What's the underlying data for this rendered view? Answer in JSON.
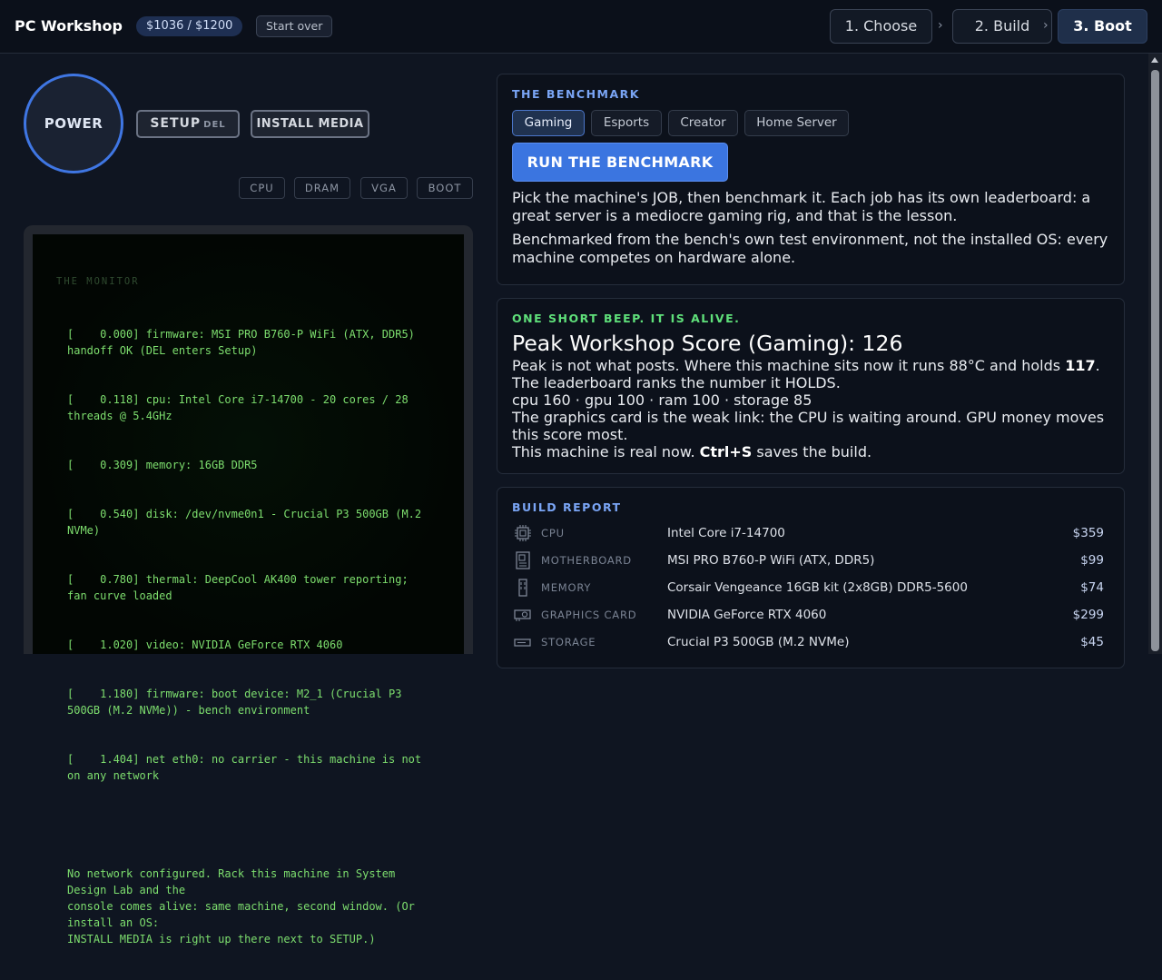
{
  "header": {
    "brand": "PC Workshop",
    "budget": "$1036 / $1200",
    "start_over": "Start over",
    "steps": [
      "1. Choose",
      "2. Build",
      "3. Boot"
    ],
    "active_step": "3. Boot",
    "chevron": "›"
  },
  "controls": {
    "power": "POWER",
    "setup": "SETUP",
    "setup_key": "DEL",
    "install_media": "INSTALL MEDIA",
    "post_leds": [
      "CPU",
      "DRAM",
      "VGA",
      "BOOT"
    ]
  },
  "monitor": {
    "title": "THE MONITOR",
    "log": [
      "[    0.000] firmware: MSI PRO B760-P WiFi (ATX, DDR5) handoff OK (DEL enters Setup)",
      "[    0.118] cpu: Intel Core i7-14700 - 20 cores / 28 threads @ 5.4GHz",
      "[    0.309] memory: 16GB DDR5",
      "[    0.540] disk: /dev/nvme0n1 - Crucial P3 500GB (M.2 NVMe)",
      "[    0.780] thermal: DeepCool AK400 tower reporting; fan curve loaded",
      "[    1.020] video: NVIDIA GeForce RTX 4060",
      "[    1.180] firmware: boot device: M2_1 (Crucial P3 500GB (M.2 NVMe)) - bench environment",
      "[    1.404] net eth0: no carrier - this machine is not on any network",
      "",
      "No network configured. Rack this machine in System Design Lab and the\nconsole comes alive: same machine, second window. (Or install an OS:\nINSTALL MEDIA is right up there next to SETUP.)"
    ]
  },
  "benchmark": {
    "label": "THE BENCHMARK",
    "tabs": [
      "Gaming",
      "Esports",
      "Creator",
      "Home Server"
    ],
    "selected_tab": "Gaming",
    "run_button": "RUN THE BENCHMARK",
    "para1": "Pick the machine's JOB, then benchmark it. Each job has its own leaderboard: a great server is a mediocre gaming rig, and that is the lesson.",
    "para2": "Benchmarked from the bench's own test environment, not the installed OS: every machine competes on hardware alone."
  },
  "result": {
    "label": "ONE SHORT BEEP. IT IS ALIVE.",
    "score_line": "Peak Workshop Score (Gaming): 126",
    "peak_pre": "Peak is not what posts. Where this machine sits now it runs 88°C and holds ",
    "holds_value": "117",
    "peak_post": ".",
    "leaderboard_line": "The leaderboard ranks the number it HOLDS.",
    "subscores": "cpu 160 · gpu 100 · ram 100 · storage 85",
    "weak_link": "The graphics card is the weak link: the CPU is waiting around. GPU money moves this score most.",
    "real_pre": "This machine is real now. ",
    "real_key": "Ctrl+S",
    "real_post": " saves the build."
  },
  "report": {
    "label": "BUILD REPORT",
    "rows": [
      {
        "category": "CPU",
        "part": "Intel Core i7-14700",
        "price": "$359",
        "icon": "cpu-icon"
      },
      {
        "category": "MOTHERBOARD",
        "part": "MSI PRO B760-P WiFi (ATX, DDR5)",
        "price": "$99",
        "icon": "motherboard-icon"
      },
      {
        "category": "MEMORY",
        "part": "Corsair Vengeance 16GB kit (2x8GB) DDR5-5600",
        "price": "$74",
        "icon": "memory-icon"
      },
      {
        "category": "GRAPHICS CARD",
        "part": "NVIDIA GeForce RTX 4060",
        "price": "$299",
        "icon": "gpu-icon"
      },
      {
        "category": "STORAGE",
        "part": "Crucial P3 500GB (M.2 NVMe)",
        "price": "$45",
        "icon": "storage-icon"
      }
    ]
  },
  "colors": {
    "accent": "#3b75e0",
    "benchmark_label": "#7aa5f5",
    "alive_label": "#5fe07a",
    "report_label": "#7aa5f5",
    "terminal_text": "#7dde6e"
  }
}
